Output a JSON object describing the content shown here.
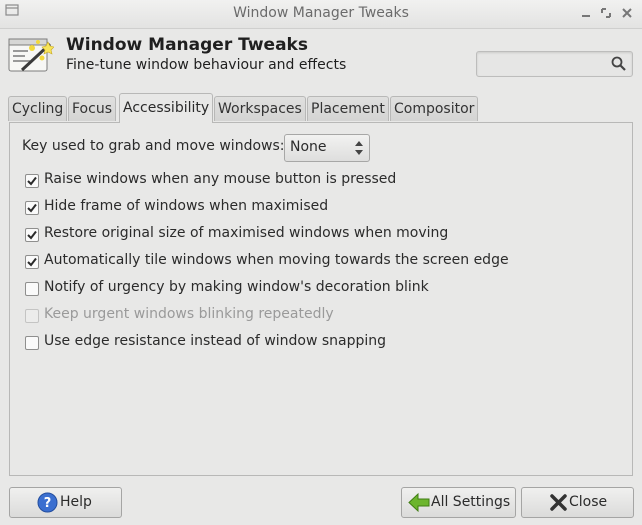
{
  "window": {
    "title": "Window Manager Tweaks"
  },
  "header": {
    "title": "Window Manager Tweaks",
    "subtitle": "Fine-tune window behaviour and effects",
    "search_value": ""
  },
  "tabs": [
    {
      "label": "Cycling",
      "active": false
    },
    {
      "label": "Focus",
      "active": false
    },
    {
      "label": "Accessibility",
      "active": true
    },
    {
      "label": "Workspaces",
      "active": false
    },
    {
      "label": "Placement",
      "active": false
    },
    {
      "label": "Compositor",
      "active": false
    }
  ],
  "accessibility": {
    "grab_label": "Key used to grab and move windows:",
    "grab_key_value": "None",
    "options": [
      {
        "label": "Raise windows when any mouse button is pressed",
        "checked": true,
        "enabled": true
      },
      {
        "label": "Hide frame of windows when maximised",
        "checked": true,
        "enabled": true
      },
      {
        "label": "Restore original size of maximised windows when moving",
        "checked": true,
        "enabled": true
      },
      {
        "label": "Automatically tile windows when moving towards the screen edge",
        "checked": true,
        "enabled": true
      },
      {
        "label": "Notify of urgency by making window's decoration blink",
        "checked": false,
        "enabled": true
      },
      {
        "label": "Keep urgent windows blinking repeatedly",
        "checked": false,
        "enabled": false
      },
      {
        "label": "Use edge resistance instead of window snapping",
        "checked": false,
        "enabled": true
      }
    ]
  },
  "footer": {
    "help_label": "Help",
    "all_settings_label": "All Settings",
    "close_label": "Close"
  },
  "colors": {
    "help_icon": "#3b6fd0",
    "all_settings_icon": "#6cb52d",
    "close_icon": "#333333"
  }
}
